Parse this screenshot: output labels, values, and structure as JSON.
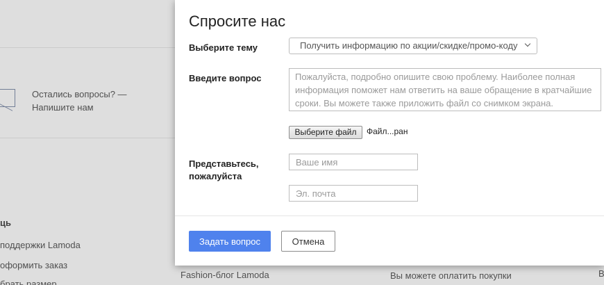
{
  "background": {
    "contact": {
      "line1": "Остались вопросы? —",
      "line2": "Напишите нам"
    },
    "left_items": [
      "ць",
      "поддержки Lamoda",
      "оформить заказ",
      "брать размер"
    ],
    "bottom_items": [
      "Fashion-блог Lamoda",
      "Вы можете оплатить покупки",
      "В"
    ]
  },
  "modal": {
    "title": "Спросите нас",
    "topic": {
      "label": "Выберите тему",
      "selected": "Получить информацию по акции/скидке/промо-коду"
    },
    "question": {
      "label": "Введите вопрос",
      "placeholder": "Пожалуйста, подробно опишите свою проблему. Наиболее полная информация поможет нам ответить на ваше обращение в кратчайшие сроки. Вы можете также приложить файл со снимком экрана."
    },
    "file": {
      "button": "Выберите файл",
      "name": "Файл...ран"
    },
    "intro": {
      "label_line1": "Представьтесь,",
      "label_line2": "пожалуйста",
      "name_placeholder": "Ваше имя",
      "email_placeholder": "Эл. почта"
    },
    "submit_label": "Задать вопрос",
    "cancel_label": "Отмена"
  },
  "colors": {
    "primary": "#4f82ed"
  }
}
